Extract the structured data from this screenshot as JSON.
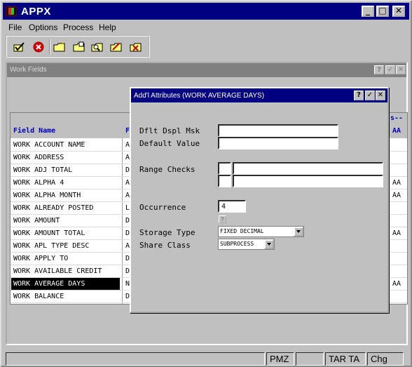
{
  "app": {
    "title": "APPX"
  },
  "window_buttons": {
    "minimize": "_",
    "maximize": "□",
    "close": "✕"
  },
  "menu": [
    "File",
    "Options",
    "Process",
    "Help"
  ],
  "toolbar": {
    "icons": [
      "ok-check-icon",
      "cancel-icon",
      "new-folder-icon",
      "open-folder-icon",
      "search-folder-icon",
      "edit-folder-icon",
      "delete-folder-icon"
    ]
  },
  "work_fields": {
    "title": "Work Fields",
    "buttons": {
      "help": "?",
      "ok": "✓",
      "close": "✕"
    },
    "header": {
      "col1": "Field Name",
      "col2": "F",
      "col3_top": "s--",
      "col3": "AA"
    },
    "rows": [
      {
        "name": "WORK ACCOUNT NAME",
        "type": "A",
        "extra": ""
      },
      {
        "name": "WORK ADDRESS",
        "type": "A",
        "extra": ""
      },
      {
        "name": "WORK ADJ TOTAL",
        "type": "D",
        "extra": ""
      },
      {
        "name": "WORK ALPHA 4",
        "type": "A",
        "extra": "AA"
      },
      {
        "name": "WORK ALPHA MONTH",
        "type": "A",
        "extra": "AA"
      },
      {
        "name": "WORK ALREADY POSTED",
        "type": "L",
        "extra": ""
      },
      {
        "name": "WORK AMOUNT",
        "type": "D",
        "extra": ""
      },
      {
        "name": "WORK AMOUNT TOTAL",
        "type": "D",
        "extra": "AA"
      },
      {
        "name": "WORK APL TYPE DESC",
        "type": "A",
        "extra": ""
      },
      {
        "name": "WORK APPLY TO",
        "type": "D",
        "extra": ""
      },
      {
        "name": "WORK AVAILABLE CREDIT",
        "type": "D",
        "extra": ""
      },
      {
        "name": "WORK AVERAGE DAYS",
        "type": "N",
        "extra": "AA"
      },
      {
        "name": "WORK BALANCE",
        "type": "D",
        "extra": ""
      }
    ],
    "selected_index": 11
  },
  "dialog": {
    "title": "Add'l Attributes (WORK AVERAGE DAYS)",
    "buttons": {
      "help": "?",
      "ok": "✓",
      "close": "✕"
    },
    "labels": {
      "dflt_dspl_msk": "Dflt Dspl Msk",
      "default_value": "Default Value",
      "range_checks": "Range Checks",
      "occurrence": "Occurrence",
      "storage_type": "Storage Type",
      "share_class": "Share Class"
    },
    "values": {
      "dflt_dspl_msk": "",
      "default_value": "",
      "range_op_1": "",
      "range_val_1": "",
      "range_op_2": "",
      "range_val_2": "",
      "occurrence": "4",
      "occurrence_help": "?",
      "storage_type": "FIXED DECIMAL",
      "share_class": "SUBPROCESS"
    }
  },
  "status": {
    "seg1": "",
    "seg2": "PMZ",
    "seg3": "",
    "seg4": "TAR TA",
    "seg5": "Chg"
  }
}
